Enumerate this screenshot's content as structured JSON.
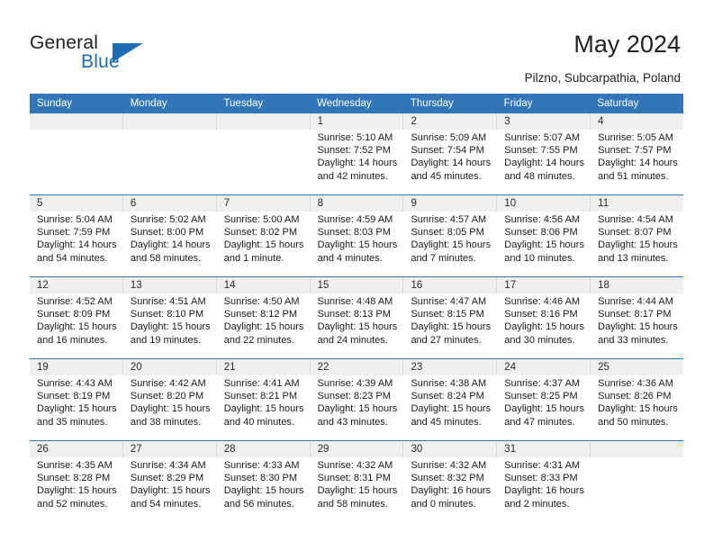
{
  "logo": {
    "word1": "General",
    "word2": "Blue",
    "accent_color": "#1f6cb4"
  },
  "header": {
    "title": "May 2024",
    "location": "Pilzno, Subcarpathia, Poland",
    "header_bar_color": "#3275b9",
    "daynum_band_color": "#efefef"
  },
  "weekdays": [
    "Sunday",
    "Monday",
    "Tuesday",
    "Wednesday",
    "Thursday",
    "Friday",
    "Saturday"
  ],
  "calendar": {
    "month": "May",
    "year": "2024",
    "weeks": [
      {
        "days": [
          {
            "num": "",
            "lines": []
          },
          {
            "num": "",
            "lines": []
          },
          {
            "num": "",
            "lines": []
          },
          {
            "num": "1",
            "lines": [
              "Sunrise: 5:10 AM",
              "Sunset: 7:52 PM",
              "Daylight: 14 hours",
              "and 42 minutes."
            ]
          },
          {
            "num": "2",
            "lines": [
              "Sunrise: 5:09 AM",
              "Sunset: 7:54 PM",
              "Daylight: 14 hours",
              "and 45 minutes."
            ]
          },
          {
            "num": "3",
            "lines": [
              "Sunrise: 5:07 AM",
              "Sunset: 7:55 PM",
              "Daylight: 14 hours",
              "and 48 minutes."
            ]
          },
          {
            "num": "4",
            "lines": [
              "Sunrise: 5:05 AM",
              "Sunset: 7:57 PM",
              "Daylight: 14 hours",
              "and 51 minutes."
            ]
          }
        ]
      },
      {
        "days": [
          {
            "num": "5",
            "lines": [
              "Sunrise: 5:04 AM",
              "Sunset: 7:59 PM",
              "Daylight: 14 hours",
              "and 54 minutes."
            ]
          },
          {
            "num": "6",
            "lines": [
              "Sunrise: 5:02 AM",
              "Sunset: 8:00 PM",
              "Daylight: 14 hours",
              "and 58 minutes."
            ]
          },
          {
            "num": "7",
            "lines": [
              "Sunrise: 5:00 AM",
              "Sunset: 8:02 PM",
              "Daylight: 15 hours",
              "and 1 minute."
            ]
          },
          {
            "num": "8",
            "lines": [
              "Sunrise: 4:59 AM",
              "Sunset: 8:03 PM",
              "Daylight: 15 hours",
              "and 4 minutes."
            ]
          },
          {
            "num": "9",
            "lines": [
              "Sunrise: 4:57 AM",
              "Sunset: 8:05 PM",
              "Daylight: 15 hours",
              "and 7 minutes."
            ]
          },
          {
            "num": "10",
            "lines": [
              "Sunrise: 4:56 AM",
              "Sunset: 8:06 PM",
              "Daylight: 15 hours",
              "and 10 minutes."
            ]
          },
          {
            "num": "11",
            "lines": [
              "Sunrise: 4:54 AM",
              "Sunset: 8:07 PM",
              "Daylight: 15 hours",
              "and 13 minutes."
            ]
          }
        ]
      },
      {
        "days": [
          {
            "num": "12",
            "lines": [
              "Sunrise: 4:52 AM",
              "Sunset: 8:09 PM",
              "Daylight: 15 hours",
              "and 16 minutes."
            ]
          },
          {
            "num": "13",
            "lines": [
              "Sunrise: 4:51 AM",
              "Sunset: 8:10 PM",
              "Daylight: 15 hours",
              "and 19 minutes."
            ]
          },
          {
            "num": "14",
            "lines": [
              "Sunrise: 4:50 AM",
              "Sunset: 8:12 PM",
              "Daylight: 15 hours",
              "and 22 minutes."
            ]
          },
          {
            "num": "15",
            "lines": [
              "Sunrise: 4:48 AM",
              "Sunset: 8:13 PM",
              "Daylight: 15 hours",
              "and 24 minutes."
            ]
          },
          {
            "num": "16",
            "lines": [
              "Sunrise: 4:47 AM",
              "Sunset: 8:15 PM",
              "Daylight: 15 hours",
              "and 27 minutes."
            ]
          },
          {
            "num": "17",
            "lines": [
              "Sunrise: 4:46 AM",
              "Sunset: 8:16 PM",
              "Daylight: 15 hours",
              "and 30 minutes."
            ]
          },
          {
            "num": "18",
            "lines": [
              "Sunrise: 4:44 AM",
              "Sunset: 8:17 PM",
              "Daylight: 15 hours",
              "and 33 minutes."
            ]
          }
        ]
      },
      {
        "days": [
          {
            "num": "19",
            "lines": [
              "Sunrise: 4:43 AM",
              "Sunset: 8:19 PM",
              "Daylight: 15 hours",
              "and 35 minutes."
            ]
          },
          {
            "num": "20",
            "lines": [
              "Sunrise: 4:42 AM",
              "Sunset: 8:20 PM",
              "Daylight: 15 hours",
              "and 38 minutes."
            ]
          },
          {
            "num": "21",
            "lines": [
              "Sunrise: 4:41 AM",
              "Sunset: 8:21 PM",
              "Daylight: 15 hours",
              "and 40 minutes."
            ]
          },
          {
            "num": "22",
            "lines": [
              "Sunrise: 4:39 AM",
              "Sunset: 8:23 PM",
              "Daylight: 15 hours",
              "and 43 minutes."
            ]
          },
          {
            "num": "23",
            "lines": [
              "Sunrise: 4:38 AM",
              "Sunset: 8:24 PM",
              "Daylight: 15 hours",
              "and 45 minutes."
            ]
          },
          {
            "num": "24",
            "lines": [
              "Sunrise: 4:37 AM",
              "Sunset: 8:25 PM",
              "Daylight: 15 hours",
              "and 47 minutes."
            ]
          },
          {
            "num": "25",
            "lines": [
              "Sunrise: 4:36 AM",
              "Sunset: 8:26 PM",
              "Daylight: 15 hours",
              "and 50 minutes."
            ]
          }
        ]
      },
      {
        "days": [
          {
            "num": "26",
            "lines": [
              "Sunrise: 4:35 AM",
              "Sunset: 8:28 PM",
              "Daylight: 15 hours",
              "and 52 minutes."
            ]
          },
          {
            "num": "27",
            "lines": [
              "Sunrise: 4:34 AM",
              "Sunset: 8:29 PM",
              "Daylight: 15 hours",
              "and 54 minutes."
            ]
          },
          {
            "num": "28",
            "lines": [
              "Sunrise: 4:33 AM",
              "Sunset: 8:30 PM",
              "Daylight: 15 hours",
              "and 56 minutes."
            ]
          },
          {
            "num": "29",
            "lines": [
              "Sunrise: 4:32 AM",
              "Sunset: 8:31 PM",
              "Daylight: 15 hours",
              "and 58 minutes."
            ]
          },
          {
            "num": "30",
            "lines": [
              "Sunrise: 4:32 AM",
              "Sunset: 8:32 PM",
              "Daylight: 16 hours",
              "and 0 minutes."
            ]
          },
          {
            "num": "31",
            "lines": [
              "Sunrise: 4:31 AM",
              "Sunset: 8:33 PM",
              "Daylight: 16 hours",
              "and 2 minutes."
            ]
          },
          {
            "num": "",
            "lines": []
          }
        ]
      }
    ]
  }
}
